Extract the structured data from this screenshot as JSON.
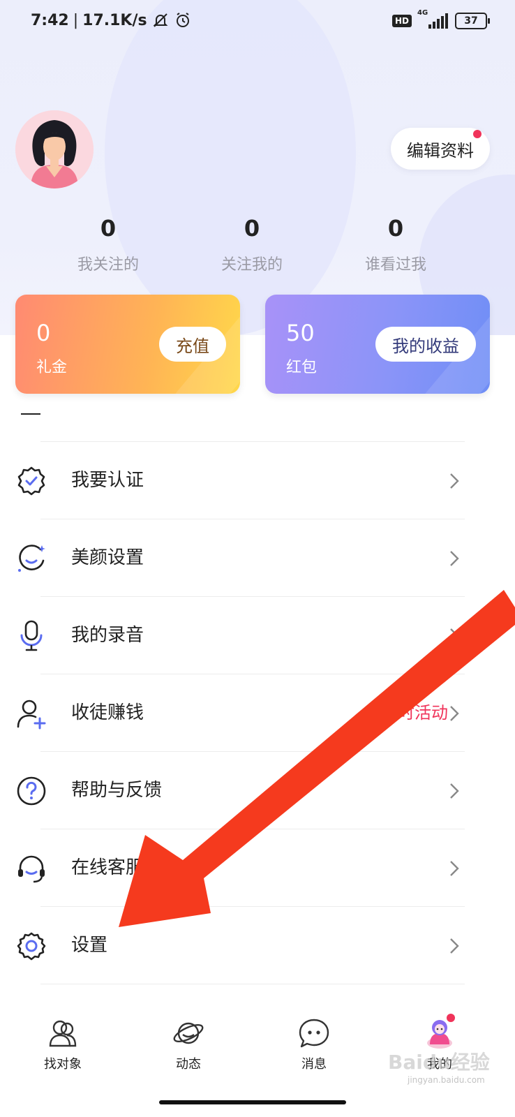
{
  "status_bar": {
    "time": "7:42",
    "separator": "|",
    "net_speed": "17.1K/s",
    "hd": "HD",
    "network_type": "4G",
    "battery": "37"
  },
  "profile": {
    "edit_label": "编辑资料"
  },
  "stats": [
    {
      "value": "0",
      "label": "我关注的"
    },
    {
      "value": "0",
      "label": "关注我的"
    },
    {
      "value": "0",
      "label": "谁看过我"
    }
  ],
  "cards": {
    "gift": {
      "value": "0",
      "name": "礼金",
      "button": "充值"
    },
    "redpacket": {
      "value": "50",
      "name": "红包",
      "button": "我的收益"
    }
  },
  "menu": [
    {
      "label": "我要认证",
      "icon": "verified-badge-icon",
      "extra": ""
    },
    {
      "label": "美颜设置",
      "icon": "beauty-face-icon",
      "extra": ""
    },
    {
      "label": "我的录音",
      "icon": "microphone-icon",
      "extra": ""
    },
    {
      "label": "收徒赚钱",
      "icon": "add-user-icon",
      "extra": "时活动"
    },
    {
      "label": "帮助与反馈",
      "icon": "help-circle-icon",
      "extra": ""
    },
    {
      "label": "在线客服",
      "icon": "headset-icon",
      "extra": ""
    },
    {
      "label": "设置",
      "icon": "gear-icon",
      "extra": ""
    }
  ],
  "tabbar": [
    {
      "label": "找对象",
      "icon": "people-icon"
    },
    {
      "label": "动态",
      "icon": "planet-icon"
    },
    {
      "label": "消息",
      "icon": "chat-bubble-icon"
    },
    {
      "label": "我的",
      "icon": "profile-mascot-icon"
    }
  ],
  "watermark": {
    "main": "Baidu经验",
    "sub": "jingyan.baidu.com"
  },
  "colors": {
    "accent_red": "#f0335a",
    "annotation_arrow": "#f53a1e",
    "icon_blue": "#5a6cf0"
  }
}
